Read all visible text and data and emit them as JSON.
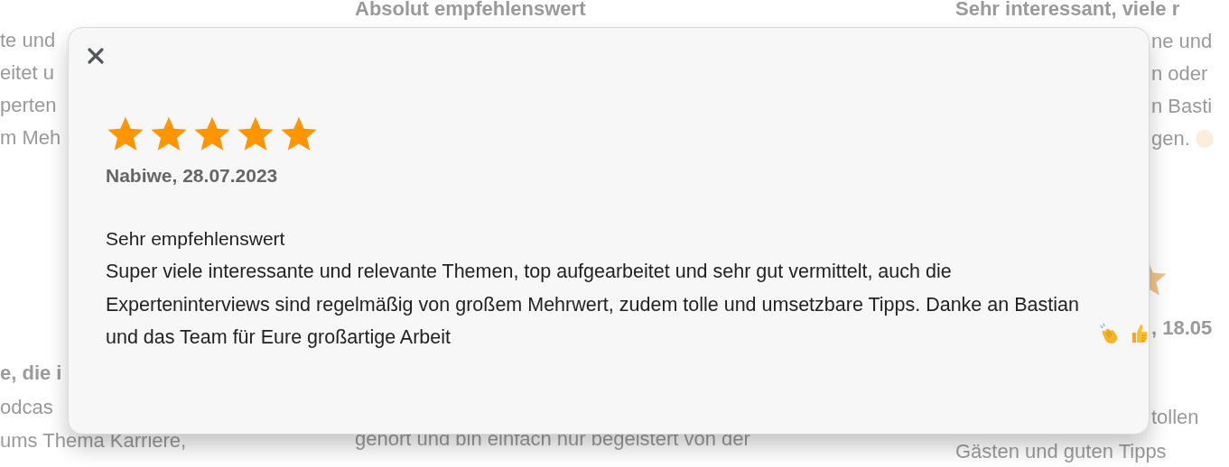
{
  "background": {
    "left_column": {
      "review_1": {
        "text_lines": [
          "te und",
          "eitet u",
          "perten",
          "m Meh"
        ]
      },
      "review_2": {
        "title": "e, die i",
        "text_lines": [
          "odcas",
          "ums Thema Karriere,"
        ]
      }
    },
    "middle_column": {
      "review_1": {
        "title": "Absolut empfehlenswert"
      },
      "review_2": {
        "text_lines": [
          "gehört und bin einfach nur begeistert von der"
        ]
      }
    },
    "right_column": {
      "review_1": {
        "title": "Sehr interessant, viele r",
        "text_lines": [
          "ne und",
          "n oder",
          "n Basti",
          "gen."
        ]
      },
      "review_2": {
        "author_date": ", 18.05",
        "text_lines": [
          "tollen",
          "Gästen und guten Tipps"
        ]
      }
    }
  },
  "review_dialog": {
    "stars": 5,
    "author_date": "Nabiwe, 28.07.2023",
    "title": "Sehr empfehlenswert",
    "text": "Super viele interessante und relevante Themen, top aufgearbeitet und sehr gut vermittelt, auch die Experteninterviews sind regelmäßig von großem Mehrwert, zudem tolle und umsetzbare Tipps. Danke an Bastian und das Team für Eure großartige Arbeit"
  }
}
